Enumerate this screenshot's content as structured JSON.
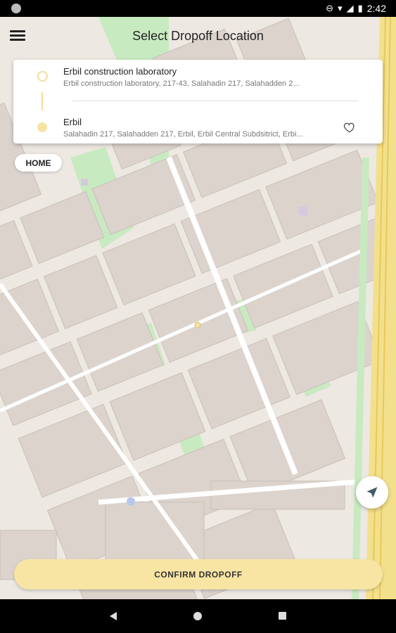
{
  "status_bar": {
    "time": "2:42"
  },
  "app_bar": {
    "title": "Select Dropoff Location",
    "menu_icon": "hamburger-menu-icon"
  },
  "route_card": {
    "pickup": {
      "name": "Erbil construction laboratory",
      "address": "Erbil construction laboratory, 217-43, Salahadin 217, Salahadden 2..."
    },
    "dropoff": {
      "name": "Erbil",
      "address": "Salahadin 217, Salahadden 217, Erbil, Erbil Central Subdsitrict, Erbi..."
    }
  },
  "home_label": "HOME",
  "confirm_label": "CONFIRM DROPOFF",
  "colors": {
    "accent": "#f8e5a4",
    "map_bg": "#ede8e1",
    "block": "#dcd3cd",
    "park": "#c8eac0",
    "road": "#ffffff",
    "highway": "#f3e08c"
  }
}
